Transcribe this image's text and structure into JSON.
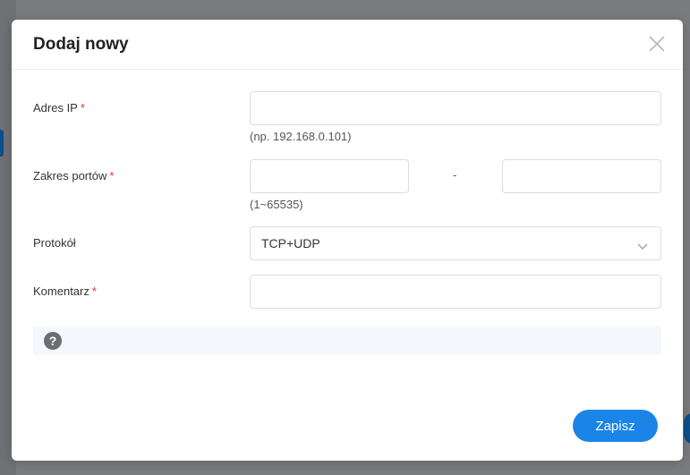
{
  "dialog": {
    "title": "Dodaj nowy",
    "close_icon": "close-icon"
  },
  "form": {
    "ip": {
      "label": "Adres IP",
      "required_mark": "*",
      "value": "",
      "hint": "(np. 192.168.0.101)"
    },
    "port_range": {
      "label": "Zakres portów",
      "required_mark": "*",
      "from_value": "",
      "to_value": "",
      "separator": "-",
      "hint": "(1~65535)"
    },
    "protocol": {
      "label": "Protokół",
      "selected": "TCP+UDP",
      "chevron_icon": "chevron-down-icon"
    },
    "comment": {
      "label": "Komentarz",
      "required_mark": "*",
      "value": ""
    }
  },
  "help": {
    "icon": "help-icon",
    "text": ""
  },
  "actions": {
    "save_label": "Zapisz"
  },
  "colors": {
    "accent": "#1a84e8",
    "required": "#e5322d",
    "help_bg": "#f4f8fd"
  }
}
